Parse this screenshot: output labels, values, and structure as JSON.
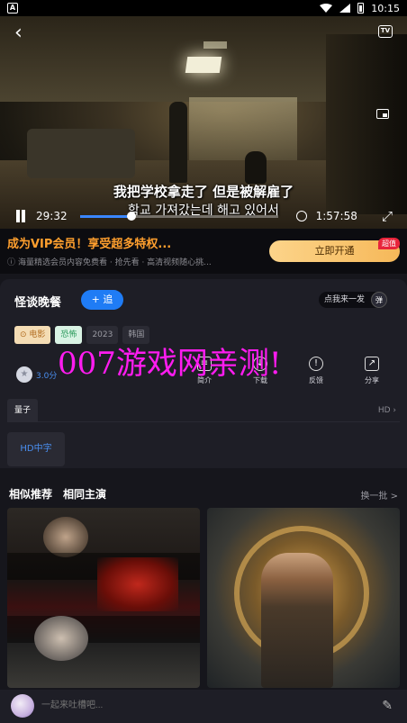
{
  "status_bar": {
    "left_icon": "A",
    "time": "10:15"
  },
  "player": {
    "subtitle_cn": "我把学校拿走了 但是被解雇了",
    "subtitle_kr": "학교 가져갔는데 해고 있어서",
    "current_time": "29:32",
    "total_time": "1:57:58",
    "progress": 0.26,
    "tv_label": "TV"
  },
  "vip": {
    "title": "成为VIP会员！享受超多特权...",
    "subtitle": "海量精选会员内容免费看 · 抢先看 · 高清视频随心挑...",
    "button": "立即开通",
    "badge": "超值"
  },
  "detail": {
    "title": "怪谈晚餐",
    "follow_label": "+ 追",
    "danmu_placeholder": "点我来一发",
    "danmu_toggle": "弹",
    "tags": [
      {
        "label": "电影",
        "style": "orange"
      },
      {
        "label": "恐怖",
        "style": "green"
      },
      {
        "label": "2023",
        "style": "gray"
      },
      {
        "label": "韩国",
        "style": "gray"
      }
    ],
    "rating": "3.0分",
    "watermark": "007游戏网亲测!",
    "actions": [
      {
        "label": "简介",
        "icon": "info-icon"
      },
      {
        "label": "下载",
        "icon": "download-icon"
      },
      {
        "label": "反馈",
        "icon": "feedback-icon"
      },
      {
        "label": "分享",
        "icon": "share-icon"
      }
    ],
    "source_tab": "量子",
    "source_quality": "HD",
    "quality_option": "HD中字"
  },
  "recommend": {
    "tabs": [
      "相似推荐",
      "相同主演"
    ],
    "more": "换一批 >"
  },
  "comment": {
    "placeholder": "一起来吐槽吧..."
  }
}
